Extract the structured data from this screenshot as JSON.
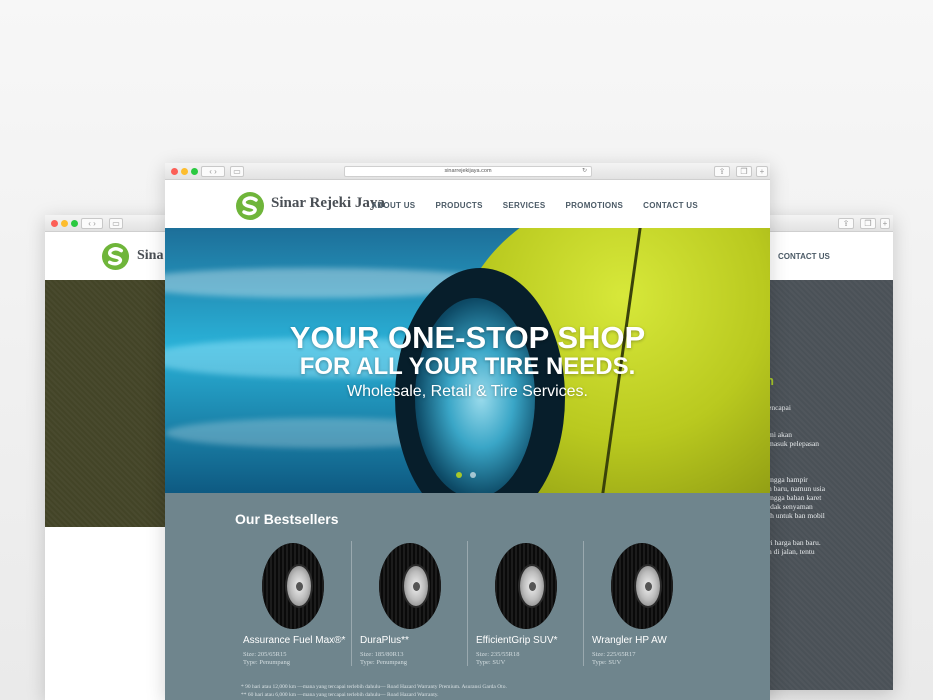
{
  "browser": {
    "url": "sinarrejekijaya.com"
  },
  "site": {
    "logo_text": "Sinar Rejeki Jaya",
    "logo_text_partial": "Sina",
    "nav": [
      {
        "label": "ABOUT US"
      },
      {
        "label": "PRODUCTS"
      },
      {
        "label": "SERVICES"
      },
      {
        "label": "PROMOTIONS"
      },
      {
        "label": "CONTACT US"
      }
    ],
    "brand_green": "#6fb53a",
    "nav_color": "#4b5a66"
  },
  "hero": {
    "line1": "YOUR ONE-STOP SHOP",
    "line2": "FOR ALL YOUR TIRE NEEDS.",
    "line3": "Wholesale, Retail & Tire Services."
  },
  "bestsellers": {
    "title": "Our Bestsellers",
    "products": [
      {
        "name": "Assurance Fuel Max®*",
        "size": "Size: 205/65R15",
        "type": "Type: Penumpang"
      },
      {
        "name": "DuraPlus**",
        "size": "Size: 185/80R13",
        "type": "Type: Penumpang"
      },
      {
        "name": "EfficientGrip SUV*",
        "size": "Size: 235/55R18",
        "type": "Type: SUV"
      },
      {
        "name": "Wrangler HP AW",
        "size": "Size: 225/65R17",
        "type": "Type: SUV"
      }
    ],
    "footnote1": "* 90 hari atau 12,000 km —mana yang tercapai terlebih dahulu— Road Hazard Warranty Premium. Asuransi Garda Oto.",
    "footnote2": "** 60 hari atau 6,000 km —mana yang tercapai terlebih dahulu— Road Hazard Warranty."
  },
  "right_window": {
    "nav_label": "CONTACT US",
    "heading_fragment": "n",
    "text_lines": [
      "encapai",
      "",
      "",
      "mi akan",
      "masuk pelepasan",
      "",
      "",
      "",
      "ingga hampir",
      "n baru, namun usia",
      "ingga bahan karet",
      "idak senyaman",
      "ih untuk ban mobil",
      "",
      "",
      "ri harga ban baru.",
      "n di jalan, tentu"
    ]
  }
}
